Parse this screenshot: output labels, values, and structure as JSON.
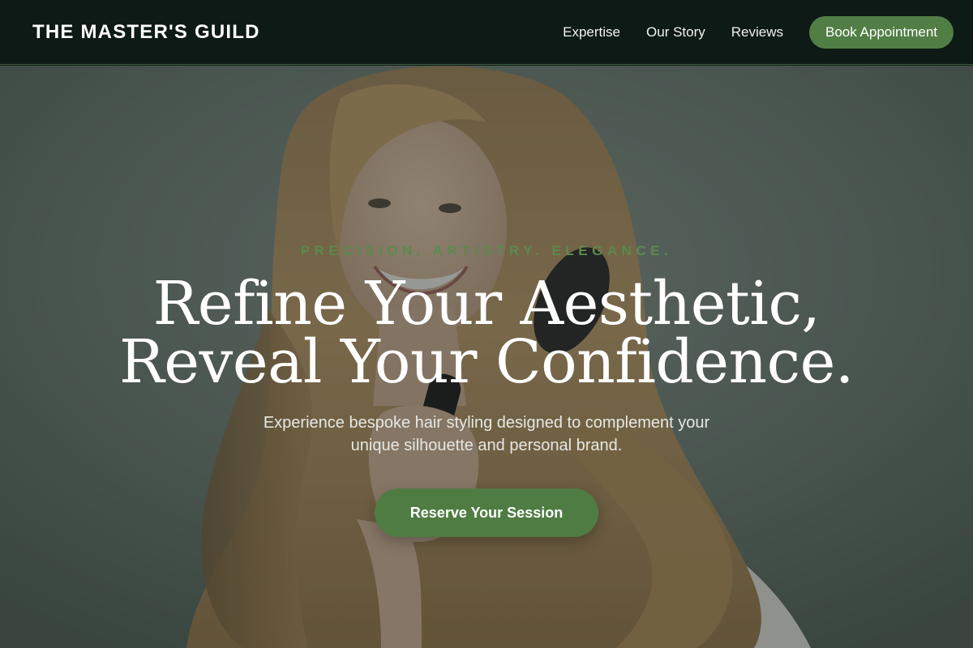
{
  "header": {
    "brand": "THE MASTER'S GUILD",
    "nav": {
      "expertise": "Expertise",
      "our_story": "Our Story",
      "reviews": "Reviews",
      "book": "Book Appointment"
    }
  },
  "hero": {
    "tagline": "PRECISION. ARTISTRY. ELEGANCE.",
    "headline_line1": "Refine Your Aesthetic,",
    "headline_line2": "Reveal Your Confidence.",
    "subtitle_line1": "Experience bespoke hair styling designed to complement your",
    "subtitle_line2": "unique silhouette and personal brand.",
    "cta": "Reserve Your Session"
  },
  "colors": {
    "header_bg": "#0e1a15",
    "accent_green": "#517e45",
    "tagline_green": "#5c8a4c",
    "text_white": "#ffffff"
  }
}
